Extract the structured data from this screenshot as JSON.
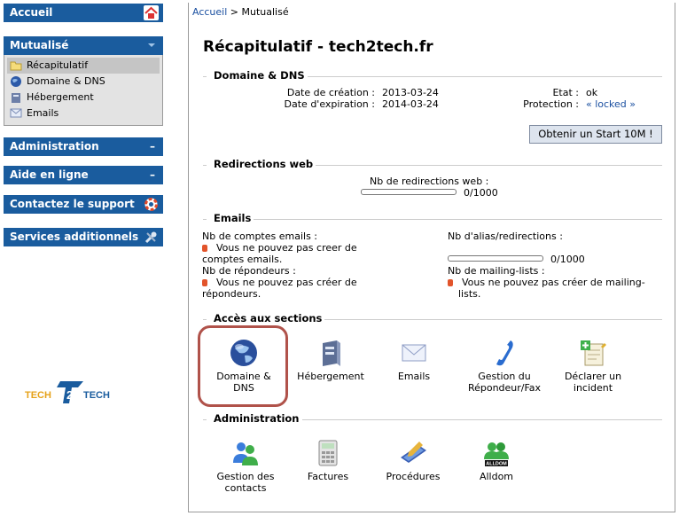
{
  "sidebar": {
    "accueil": "Accueil",
    "mutualise": "Mutualisé",
    "items": [
      {
        "label": "Récapitulatif"
      },
      {
        "label": "Domaine & DNS"
      },
      {
        "label": "Hébergement"
      },
      {
        "label": "Emails"
      }
    ],
    "administration": "Administration",
    "aide": "Aide en ligne",
    "contact": "Contactez le support",
    "services": "Services additionnels",
    "minus": "–"
  },
  "logo": {
    "text": "TECH2TECH"
  },
  "breadcrumb": {
    "home": "Accueil",
    "sep": ">",
    "current": "Mutualisé"
  },
  "main": {
    "title": "Récapitulatif - tech2tech.fr",
    "dns": {
      "legend": "Domaine & DNS",
      "creation_label": "Date de création :",
      "creation": "2013-03-24",
      "expiration_label": "Date d'expiration :",
      "expiration": "2014-03-24",
      "etat_label": "Etat :",
      "etat": "ok",
      "protection_label": "Protection :",
      "protection": "« locked »",
      "button": "Obtenir un Start 10M !"
    },
    "redir": {
      "legend": "Redirections web",
      "label": "Nb de redirections web :",
      "value": "0/1000",
      "fill": 0
    },
    "emails": {
      "legend": "Emails",
      "accounts_label": "Nb de comptes emails :",
      "accounts_msg1": "Vous ne pouvez pas creer de",
      "accounts_msg2": "comptes emails.",
      "responders_label": "Nb de répondeurs :",
      "responders_msg1": "Vous ne pouvez pas créer de",
      "responders_msg2": "répondeurs.",
      "alias_label": "Nb d'alias/redirections :",
      "alias_value": "0/1000",
      "alias_fill": 0,
      "ml_label": "Nb de mailing-lists :",
      "ml_msg1": "Vous ne pouvez pas créer de mailing-",
      "ml_msg2": "lists."
    },
    "sections": {
      "legend": "Accès aux sections",
      "items": [
        {
          "l1": "Domaine &",
          "l2": "DNS"
        },
        {
          "l1": "Hébergement",
          "l2": ""
        },
        {
          "l1": "Emails",
          "l2": ""
        },
        {
          "l1": "Gestion du",
          "l2": "Répondeur/Fax"
        },
        {
          "l1": "Déclarer un",
          "l2": "incident"
        }
      ]
    },
    "admin": {
      "legend": "Administration",
      "items": [
        {
          "l1": "Gestion des",
          "l2": "contacts"
        },
        {
          "l1": "Factures",
          "l2": ""
        },
        {
          "l1": "Procédures",
          "l2": ""
        },
        {
          "l1": "Alldom",
          "l2": ""
        }
      ]
    },
    "alldom_badge": "ALLDOM"
  },
  "colors": {
    "sidebar": "#1a5c9e",
    "highlight": "#b0524a",
    "status_dot": "#e2542b"
  }
}
